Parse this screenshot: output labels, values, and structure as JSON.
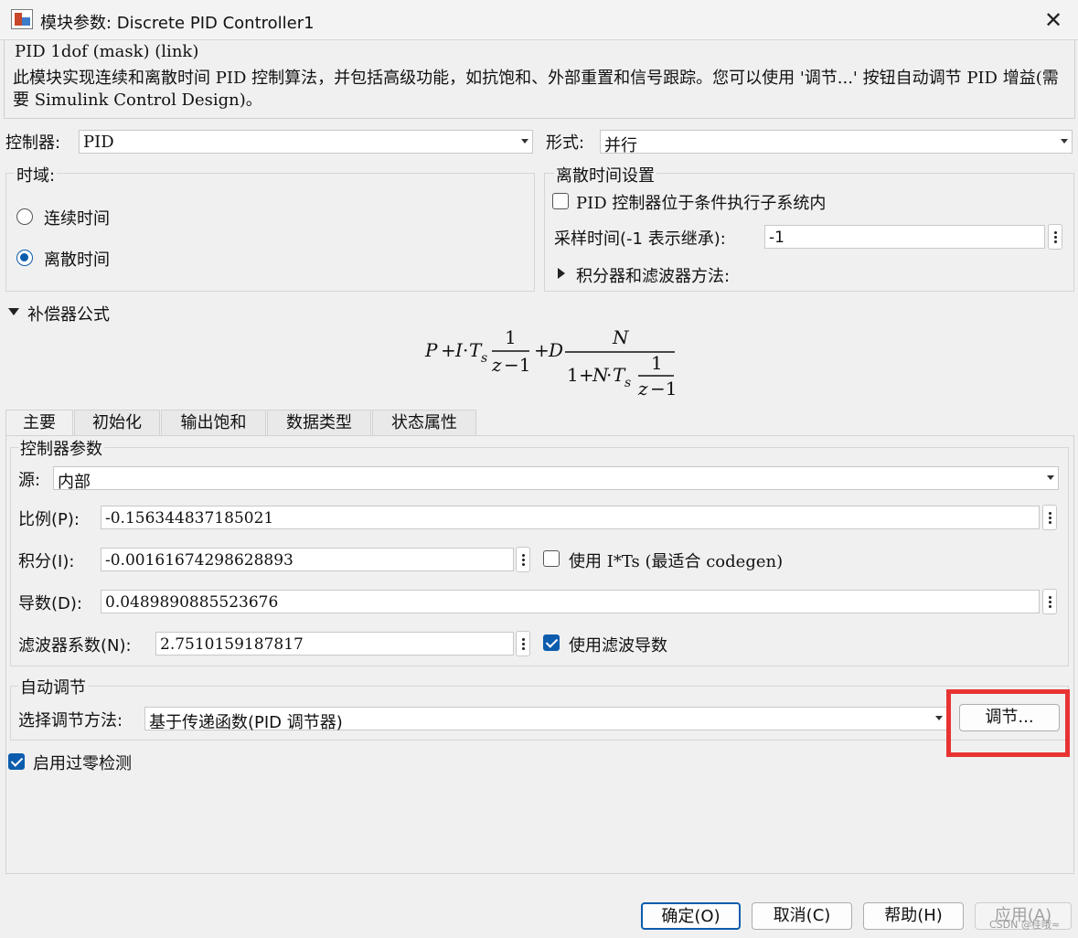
{
  "window": {
    "title": "模块参数: Discrete PID Controller1"
  },
  "description": {
    "header": "PID 1dof (mask) (link)",
    "text": "此模块实现连续和离散时间 PID 控制算法，并包括高级功能，如抗饱和、外部重置和信号跟踪。您可以使用 '调节...' 按钮自动调节 PID 增益(需要 Simulink Control Design)。"
  },
  "controller": {
    "label": "控制器:",
    "value": "PID"
  },
  "form": {
    "label": "形式:",
    "value": "并行"
  },
  "time_domain": {
    "title": "时域:",
    "options": [
      "连续时间",
      "离散时间"
    ],
    "selected": "离散时间"
  },
  "discrete_settings": {
    "title": "离散时间设置",
    "conditional_checkbox_label": "PID 控制器位于条件执行子系统内",
    "conditional_checked": false,
    "sample_time_label": "采样时间(-1 表示继承):",
    "sample_time_value": "-1",
    "integrator_filter_label": "积分器和滤波器方法:"
  },
  "compensator": {
    "title": "补偿器公式"
  },
  "tabs": [
    "主要",
    "初始化",
    "输出饱和",
    "数据类型",
    "状态属性"
  ],
  "active_tab": "主要",
  "params": {
    "title": "控制器参数",
    "source_label": "源:",
    "source_value": "内部",
    "p_label": "比例(P):",
    "p_value": "-0.156344837185021",
    "i_label": "积分(I):",
    "i_value": "-0.00161674298628893",
    "its_label": "使用 I*Ts (最适合 codegen)",
    "its_checked": false,
    "d_label": "导数(D):",
    "d_value": "0.0489890885523676",
    "n_label": "滤波器系数(N):",
    "n_value": "2.7510159187817",
    "use_filter_label": "使用滤波导数",
    "use_filter_checked": true
  },
  "autotune": {
    "title": "自动调节",
    "method_label": "选择调节方法:",
    "method_value": "基于传递函数(PID 调节器)",
    "tune_button": "调节..."
  },
  "zero_crossing": {
    "label": "启用过零检测",
    "checked": true
  },
  "footer": {
    "ok": "确定(O)",
    "cancel": "取消(C)",
    "help": "帮助(H)",
    "apply": "应用(A)"
  },
  "watermark": "CSDN @桂哦≈",
  "colors": {
    "accent": "#0b5cad",
    "highlight": "#e83333"
  }
}
